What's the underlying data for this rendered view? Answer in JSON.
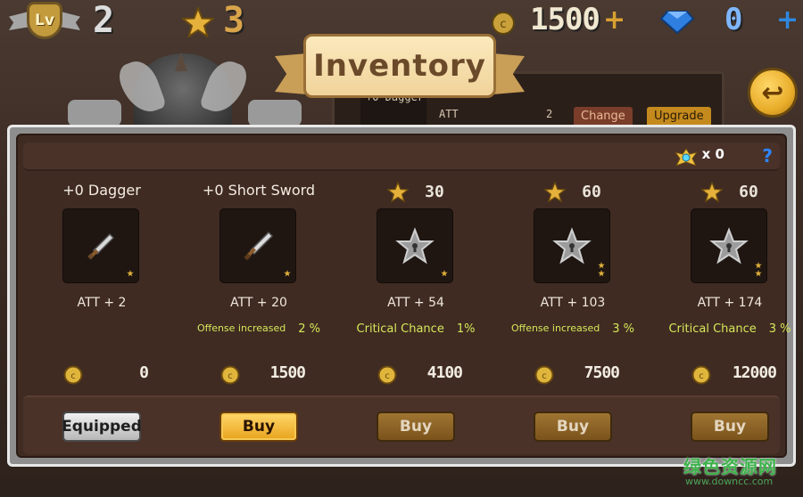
{
  "hud": {
    "level_badge": "Lv",
    "level": "2",
    "stars": "3",
    "gold": "1500",
    "gold_plus": "+",
    "gems": "0",
    "gems_plus": "+"
  },
  "background": {
    "slot_label": "+0 Dagger",
    "att_label": "ATT",
    "att_value": "2",
    "change_label": "Change",
    "upgrade_label": "Upgrade"
  },
  "title": "Inventory",
  "emblem_count": "x 0",
  "help_symbol": "?",
  "back_symbol": "↩",
  "items": [
    {
      "kind": "title",
      "title": "+0 Dagger",
      "att": "ATT + 2",
      "bonus_label": "",
      "bonus_value": "",
      "price": "0",
      "stars": 1,
      "button": "Equipped",
      "button_state": "equipped",
      "icon": "dagger-icon"
    },
    {
      "kind": "title",
      "title": "+0 Short Sword",
      "att": "ATT + 20",
      "bonus_label": "Offense increased",
      "bonus_value": "2 %",
      "price": "1500",
      "stars": 1,
      "button": "Buy",
      "button_state": "active",
      "icon": "sword-icon"
    },
    {
      "kind": "locked",
      "req": "30",
      "att": "ATT + 54",
      "bonus_label": "Critical Chance",
      "bonus_value": "1%",
      "price": "4100",
      "stars": 1,
      "button": "Buy",
      "button_state": "dim",
      "icon": "locked-star-icon"
    },
    {
      "kind": "locked",
      "req": "60",
      "att": "ATT + 103",
      "bonus_label": "Offense increased",
      "bonus_value": "3 %",
      "price": "7500",
      "stars": 2,
      "button": "Buy",
      "button_state": "dim",
      "icon": "locked-star-icon"
    },
    {
      "kind": "locked",
      "req": "60",
      "att": "ATT + 174",
      "bonus_label": "Critical Chance",
      "bonus_value": "3 %",
      "price": "12000",
      "stars": 2,
      "button": "Buy",
      "button_state": "dim",
      "icon": "locked-star-icon"
    }
  ],
  "watermark": {
    "text": "绿色资源网",
    "url": "www.downcc.com"
  },
  "colors": {
    "gold": "#e8a21c",
    "bonus_text": "#d6e85a",
    "panel_bg": "#3f2b22",
    "gem": "#2e88e0"
  }
}
